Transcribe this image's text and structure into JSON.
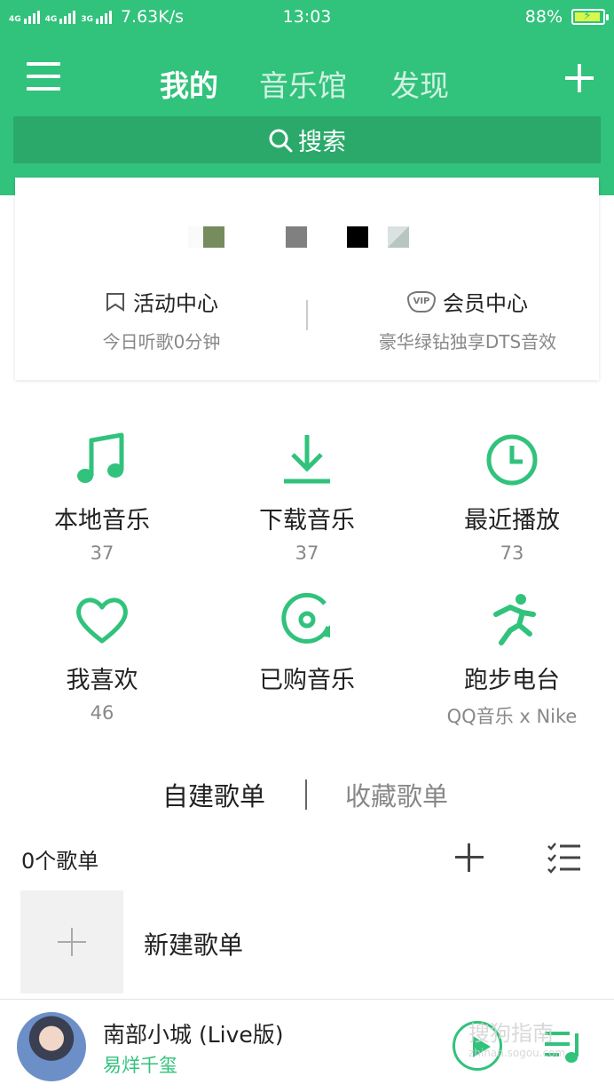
{
  "status_bar": {
    "network_1": "4G",
    "network_2": "4G",
    "network_3": "3G",
    "speed": "7.63K/s",
    "time": "13:03",
    "battery": "88%"
  },
  "header": {
    "tabs": [
      {
        "label": "我的",
        "active": true
      },
      {
        "label": "音乐馆",
        "active": false
      },
      {
        "label": "发现",
        "active": false
      }
    ],
    "search_label": "搜索"
  },
  "card": {
    "activity": {
      "title": "活动中心",
      "subtitle": "今日听歌0分钟"
    },
    "vip": {
      "title": "会员中心",
      "subtitle": "豪华绿钻独享DTS音效",
      "badge": "VIP"
    }
  },
  "grid": [
    {
      "icon": "music-note-icon",
      "label": "本地音乐",
      "count": "37"
    },
    {
      "icon": "download-icon",
      "label": "下载音乐",
      "count": "37"
    },
    {
      "icon": "clock-icon",
      "label": "最近播放",
      "count": "73"
    },
    {
      "icon": "heart-icon",
      "label": "我喜欢",
      "count": "46"
    },
    {
      "icon": "disc-icon",
      "label": "已购音乐",
      "count": ""
    },
    {
      "icon": "runner-icon",
      "label": "跑步电台",
      "count": "QQ音乐 x Nike"
    }
  ],
  "playlists": {
    "tabs": [
      {
        "label": "自建歌单",
        "active": true
      },
      {
        "label": "收藏歌单",
        "active": false
      }
    ],
    "count_label": "0个歌单",
    "new_label": "新建歌单"
  },
  "player": {
    "song": "南部小城 (Live版)",
    "artist": "易烊千玺"
  },
  "watermark": {
    "text": "搜狗指南",
    "sub": "zhinan.sogou.com"
  },
  "colors": {
    "accent": "#31c27c",
    "search_bg": "#2aa96a"
  }
}
